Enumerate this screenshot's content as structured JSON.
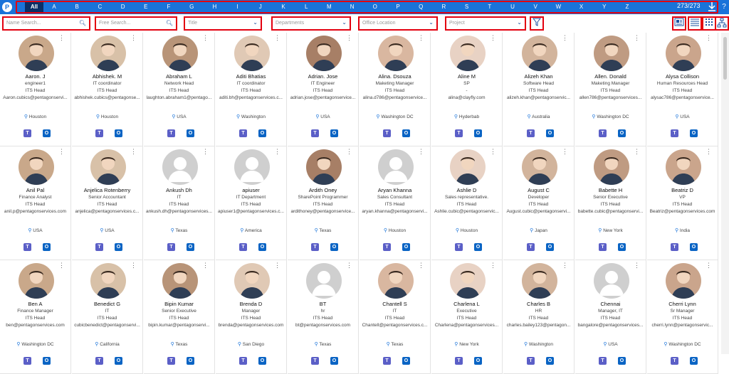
{
  "topbar": {
    "logo": "P",
    "letters": [
      "All",
      "A",
      "B",
      "C",
      "D",
      "E",
      "F",
      "G",
      "H",
      "I",
      "J",
      "K",
      "L",
      "M",
      "N",
      "O",
      "P",
      "Q",
      "R",
      "S",
      "T",
      "U",
      "V",
      "W",
      "X",
      "Y",
      "Z"
    ],
    "count": "273/273",
    "download_icon": "download-icon",
    "help": "?"
  },
  "filters": {
    "name_search": "Name Search...",
    "free_search": "Free Search...",
    "title": "Title",
    "departments": "Departments",
    "office_location": "Office Location",
    "project": "Project"
  },
  "colors": {
    "accent": "#1a73d9",
    "highlight": "#e3000f",
    "teams": "#5b5fc7",
    "outlook": "#0a64c4"
  },
  "people": [
    {
      "name": "Aaron. J",
      "title": "engineer1",
      "dept": "ITS Head",
      "email": "Aaron.cubics@pentagonservi...",
      "loc": "Houston"
    },
    {
      "name": "Abhishek. M",
      "title": "IT coordinator",
      "dept": "ITS Head",
      "email": "abhishek.cubics@pentagonse...",
      "loc": "Houston"
    },
    {
      "name": "Abraham L",
      "title": "Network Head",
      "dept": "ITS Head",
      "email": "laughton.abraham1@pentago...",
      "loc": "USA"
    },
    {
      "name": "Aditi Bhatias",
      "title": "IT coordinator",
      "dept": "ITS Head",
      "email": "aditi.bh@pentagonservices.c...",
      "loc": "Washington"
    },
    {
      "name": "Adrian. Jose",
      "title": "IT Engineer",
      "dept": "ITS Head",
      "email": "adrian.jose@pentagonservice...",
      "loc": "USA"
    },
    {
      "name": "Alina. Dsouza",
      "title": "Maketing Manager",
      "dept": "ITS Head",
      "email": "alina.d786@pentagonservice...",
      "loc": "Washington DC"
    },
    {
      "name": "Aline M",
      "title": "SP",
      "dept": "-",
      "email": "alina@clayfly.com",
      "loc": "Hyderbab"
    },
    {
      "name": "Alizeh Khan",
      "title": "Software Head",
      "dept": "ITS Head",
      "email": "alizeh.khan@pentagonservic...",
      "loc": "Australia"
    },
    {
      "name": "Allen. Donald",
      "title": "Maketing Manager",
      "dept": "ITS Head",
      "email": "allen786@pentagonservices...",
      "loc": "Washington DC"
    },
    {
      "name": "Alysa Collison",
      "title": "Human Resources Head",
      "dept": "ITS Head",
      "email": "alysac786@pentagonservice...",
      "loc": "USA"
    },
    {
      "name": "Anil Pal",
      "title": "Finance Analyst",
      "dept": "ITS Head",
      "email": "anil.p@pentagonservices.com",
      "loc": "USA"
    },
    {
      "name": "Anjelica Rotenberry",
      "title": "Senior Accountant",
      "dept": "ITS Head",
      "email": "anjelica@pentagonservices.c...",
      "loc": "USA"
    },
    {
      "name": "Ankush Dh",
      "title": "IT",
      "dept": "ITS Head",
      "email": "ankush.dh@pentagonservices...",
      "loc": "Texas"
    },
    {
      "name": "apiuser",
      "title": "IT Department",
      "dept": "ITS Head",
      "email": "apiuser1@pentagonservices.c...",
      "loc": "America"
    },
    {
      "name": "Ardith Oney",
      "title": "SharePoint Programmer",
      "dept": "ITS Head",
      "email": "ardithoney@pentagonservice...",
      "loc": "Texas"
    },
    {
      "name": "Aryan Khanna",
      "title": "Sales Consultant",
      "dept": "ITS Head",
      "email": "aryan.khanna@pentagonservi...",
      "loc": "Houston"
    },
    {
      "name": "Ashlie D",
      "title": "Sales representative.",
      "dept": "ITS Head",
      "email": "Ashlie.cubic@pentagonservic...",
      "loc": "Houston"
    },
    {
      "name": "August C",
      "title": "Developer",
      "dept": "ITS Head",
      "email": "August.cubic@pentagonservi...",
      "loc": "Japan"
    },
    {
      "name": "Babette H",
      "title": "Senior Executive",
      "dept": "ITS Head",
      "email": "babette.cubic@pentagonservi...",
      "loc": "New York"
    },
    {
      "name": "Beatriz D",
      "title": "VP",
      "dept": "ITS Head",
      "email": "Beatriz@pentagonservices.com",
      "loc": "India"
    },
    {
      "name": "Ben A",
      "title": "Finance Manager",
      "dept": "ITS Head",
      "email": "ben@pentagonservices.com",
      "loc": "Washington DC"
    },
    {
      "name": "Benedict G",
      "title": "IT",
      "dept": "ITS Head",
      "email": "cubicbenedict@pentagonservi...",
      "loc": "California"
    },
    {
      "name": "Bipin Kumar",
      "title": "Senior Executive",
      "dept": "ITS Head",
      "email": "bipin.kumar@pentagonservi...",
      "loc": "Texas"
    },
    {
      "name": "Brenda D",
      "title": "Manager",
      "dept": "ITS Head",
      "email": "brenda@pentagonservices.com",
      "loc": "San Diego"
    },
    {
      "name": "BT",
      "title": "hr",
      "dept": "ITS Head",
      "email": "bt@pentagonservices.com",
      "loc": "Texas"
    },
    {
      "name": "Chantell S",
      "title": "IT",
      "dept": "ITS Head",
      "email": "Chantell@pentagonservices.c...",
      "loc": "Texas"
    },
    {
      "name": "Charlena L",
      "title": "Executive",
      "dept": "ITS Head",
      "email": "Charlena@pentagonservices...",
      "loc": "New York"
    },
    {
      "name": "Charles B",
      "title": "HR",
      "dept": "ITS Head",
      "email": "charles.bailey123@pentagon...",
      "loc": "Washington"
    },
    {
      "name": "Chennai",
      "title": "Manager, IT",
      "dept": "ITS Head",
      "email": "bangalore@pentagonservices...",
      "loc": "USA"
    },
    {
      "name": "Cherri Lynn",
      "title": "Sr Manager",
      "dept": "ITS Head",
      "email": "cherri.lynn@pentagonservic...",
      "loc": "Washington DC"
    }
  ]
}
